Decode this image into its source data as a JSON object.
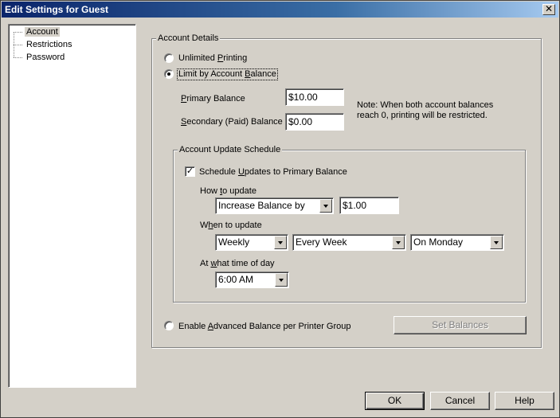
{
  "window": {
    "title": "Edit Settings for Guest",
    "close_label": "✕"
  },
  "tree": {
    "items": [
      "Account",
      "Restrictions",
      "Password"
    ]
  },
  "account_details": {
    "title": "Account Details",
    "unlimited_printing": {
      "before": "Unlimited ",
      "key": "P",
      "after": "rinting",
      "checked": false
    },
    "limit_by_balance": {
      "before": "Limit by Account ",
      "key": "B",
      "after": "alance",
      "checked": true
    },
    "primary_balance": {
      "label_key": "P",
      "label_rest": "rimary Balance",
      "value": "$10.00"
    },
    "secondary_balance": {
      "label_key": "S",
      "label_rest": "econdary (Paid) Balance",
      "value": "$0.00"
    },
    "note_line1": "Note: When both account balances",
    "note_line2": "reach 0, printing will be restricted."
  },
  "schedule": {
    "title": "Account Update Schedule",
    "checkbox": {
      "before": "Schedule ",
      "key": "U",
      "after": "pdates to Primary Balance",
      "checked": true
    },
    "how_label": {
      "before": "How ",
      "key": "t",
      "after": "o update"
    },
    "how_select": "Increase Balance by",
    "how_amount": "$1.00",
    "when_label": {
      "before": "W",
      "key": "h",
      "after": "en to update"
    },
    "when_period": "Weekly",
    "when_frequency": "Every Week",
    "when_day": "On Monday",
    "time_label": {
      "before": "At ",
      "key": "w",
      "after": "hat time of day"
    },
    "time_select": "6:00 AM"
  },
  "advanced": {
    "before": "Enable ",
    "key": "A",
    "after": "dvanced Balance per Printer Group",
    "checked": false
  },
  "buttons": {
    "set_balances": "Set Balances",
    "ok": "OK",
    "cancel": "Cancel",
    "help": "Help"
  }
}
